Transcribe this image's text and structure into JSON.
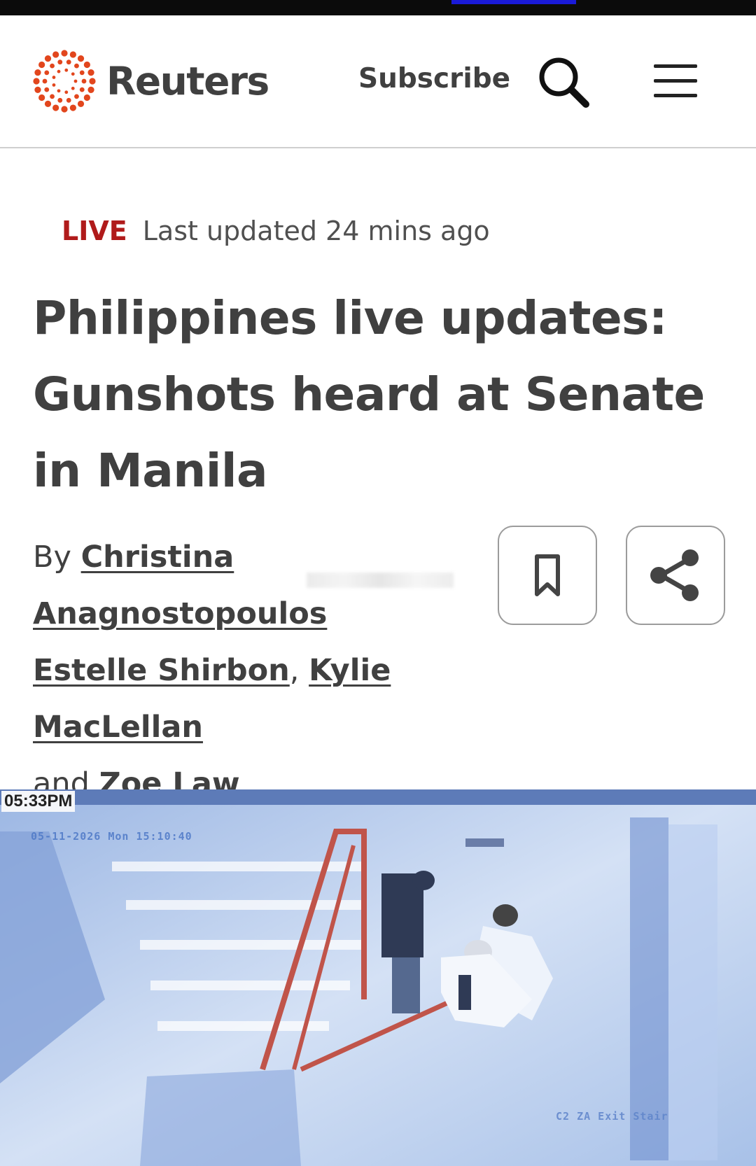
{
  "header": {
    "brand": "Reuters",
    "subscribe_label": "Subscribe",
    "search_icon": "search-icon",
    "menu_icon": "hamburger-menu-icon",
    "brand_color": "#e2461d"
  },
  "article": {
    "live_label": "LIVE",
    "updated_text": "Last updated 24 mins ago",
    "headline": "Philippines live updates: Gunshots heard at Senate in Manila",
    "by_prefix": "By",
    "authors": [
      "Christina Anagnostopoulos",
      "Estelle Shirbon",
      "Kylie MacLellan",
      "Zoe Law"
    ],
    "separator_comma": ",",
    "and_text": "and",
    "bookmark_icon": "bookmark-icon",
    "share_icon": "share-icon",
    "live_color": "#b01b1b"
  },
  "media": {
    "clock": "05:33PM",
    "cctv_timestamp": "05-11-2026 Mon 15:10:40",
    "cctv_location": "C2 ZA Exit Stair"
  }
}
